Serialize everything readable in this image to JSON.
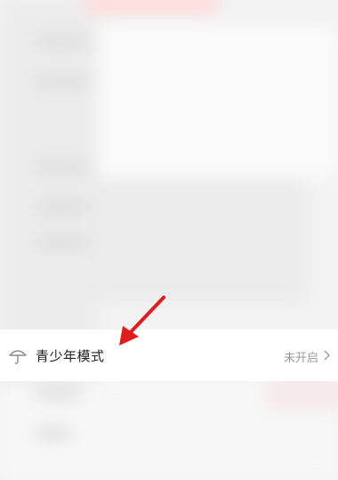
{
  "youth_mode": {
    "icon": "umbrella-icon",
    "label": "青少年模式",
    "status": "未开启"
  },
  "annotation": {
    "arrow_color": "#e31b1b"
  }
}
